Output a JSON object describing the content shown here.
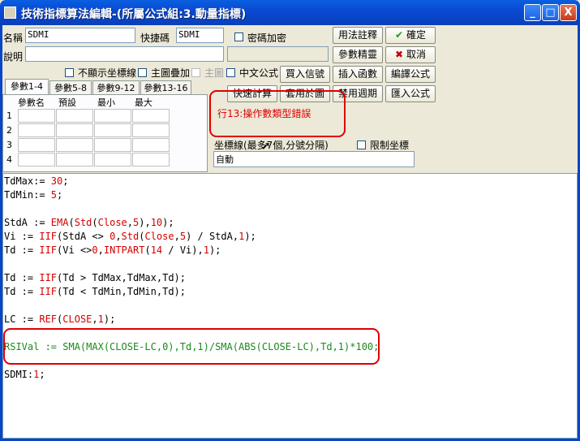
{
  "window": {
    "title": "技術指標算法編輯-(所屬公式組:3.動量指標)",
    "min_label": "_",
    "max_label": "□",
    "close_label": "X"
  },
  "form": {
    "name_label": "名稱",
    "name_value": "SDMI",
    "hotkey_label": "快捷碼",
    "hotkey_value": "SDMI",
    "password_label": "密碼加密",
    "desc_label": "說明",
    "desc_value": "",
    "hide_axis_label": "不顯示坐標線",
    "main_overlay_label": "主圖疊加",
    "main_label": "主圖",
    "chinese_label": "中文公式"
  },
  "buttons": {
    "usage": "用法註釋",
    "ok": "確定",
    "params": "參數精靈",
    "cancel": "取消",
    "buy_signal": "買入信號",
    "insert_func": "插入函數",
    "compile": "編譯公式",
    "quick_calc": "快速計算",
    "use_in_chart": "套用於圖",
    "disable_period": "禁用週期",
    "import": "匯入公式"
  },
  "tabs": [
    "參數1-4",
    "參數5-8",
    "參數9-12",
    "參數13-16"
  ],
  "param_grid": {
    "headers": [
      "參數名",
      "預設",
      "最小",
      "最大"
    ],
    "rows": [
      "1",
      "2",
      "3",
      "4"
    ]
  },
  "error_message": "行13:操作數類型錯誤",
  "axis": {
    "label": "坐標線(最多7個,分號分隔)",
    "limit_label": "限制坐標",
    "value": "自動"
  },
  "code_lines": [
    [
      [
        "TdMax:= ",
        "k"
      ],
      [
        "30",
        "n"
      ],
      [
        ";",
        "k"
      ]
    ],
    [
      [
        "TdMin:= ",
        "k"
      ],
      [
        "5",
        "n"
      ],
      [
        ";",
        "k"
      ]
    ],
    [],
    [
      [
        "StdA := ",
        "k"
      ],
      [
        "EMA",
        "f"
      ],
      [
        "(",
        "k"
      ],
      [
        "Std",
        "f"
      ],
      [
        "(",
        "k"
      ],
      [
        "Close",
        "f"
      ],
      [
        ",",
        "k"
      ],
      [
        "5",
        "n"
      ],
      [
        "),",
        "k"
      ],
      [
        "10",
        "n"
      ],
      [
        ");",
        "k"
      ]
    ],
    [
      [
        "Vi := ",
        "k"
      ],
      [
        "IIF",
        "f"
      ],
      [
        "(StdA <> ",
        "k"
      ],
      [
        "0",
        "n"
      ],
      [
        ",",
        "k"
      ],
      [
        "Std",
        "f"
      ],
      [
        "(",
        "k"
      ],
      [
        "Close",
        "f"
      ],
      [
        ",",
        "k"
      ],
      [
        "5",
        "n"
      ],
      [
        ") / StdA,",
        "k"
      ],
      [
        "1",
        "n"
      ],
      [
        ");",
        "k"
      ]
    ],
    [
      [
        "Td := ",
        "k"
      ],
      [
        "IIF",
        "f"
      ],
      [
        "(Vi <>",
        "k"
      ],
      [
        "0",
        "n"
      ],
      [
        ",",
        "k"
      ],
      [
        "INTPART",
        "f"
      ],
      [
        "(",
        "k"
      ],
      [
        "14",
        "n"
      ],
      [
        " / Vi),",
        "k"
      ],
      [
        "1",
        "n"
      ],
      [
        ");",
        "k"
      ]
    ],
    [],
    [
      [
        "Td := ",
        "k"
      ],
      [
        "IIF",
        "f"
      ],
      [
        "(Td > TdMax,TdMax,Td);",
        "k"
      ]
    ],
    [
      [
        "Td := ",
        "k"
      ],
      [
        "IIF",
        "f"
      ],
      [
        "(Td < TdMin,TdMin,Td);",
        "k"
      ]
    ],
    [],
    [
      [
        "LC := ",
        "k"
      ],
      [
        "REF",
        "f"
      ],
      [
        "(",
        "k"
      ],
      [
        "CLOSE",
        "f"
      ],
      [
        ",",
        "k"
      ],
      [
        "1",
        "n"
      ],
      [
        ");",
        "k"
      ]
    ],
    [],
    [
      [
        "RSIVal := SMA(MAX(CLOSE-LC,0),Td,1)/SMA(ABS(CLOSE-LC),Td,1)*100;",
        "g"
      ]
    ],
    [],
    [
      [
        "SDMI:",
        "k"
      ],
      [
        "1",
        "n"
      ],
      [
        ";",
        "k"
      ]
    ]
  ]
}
